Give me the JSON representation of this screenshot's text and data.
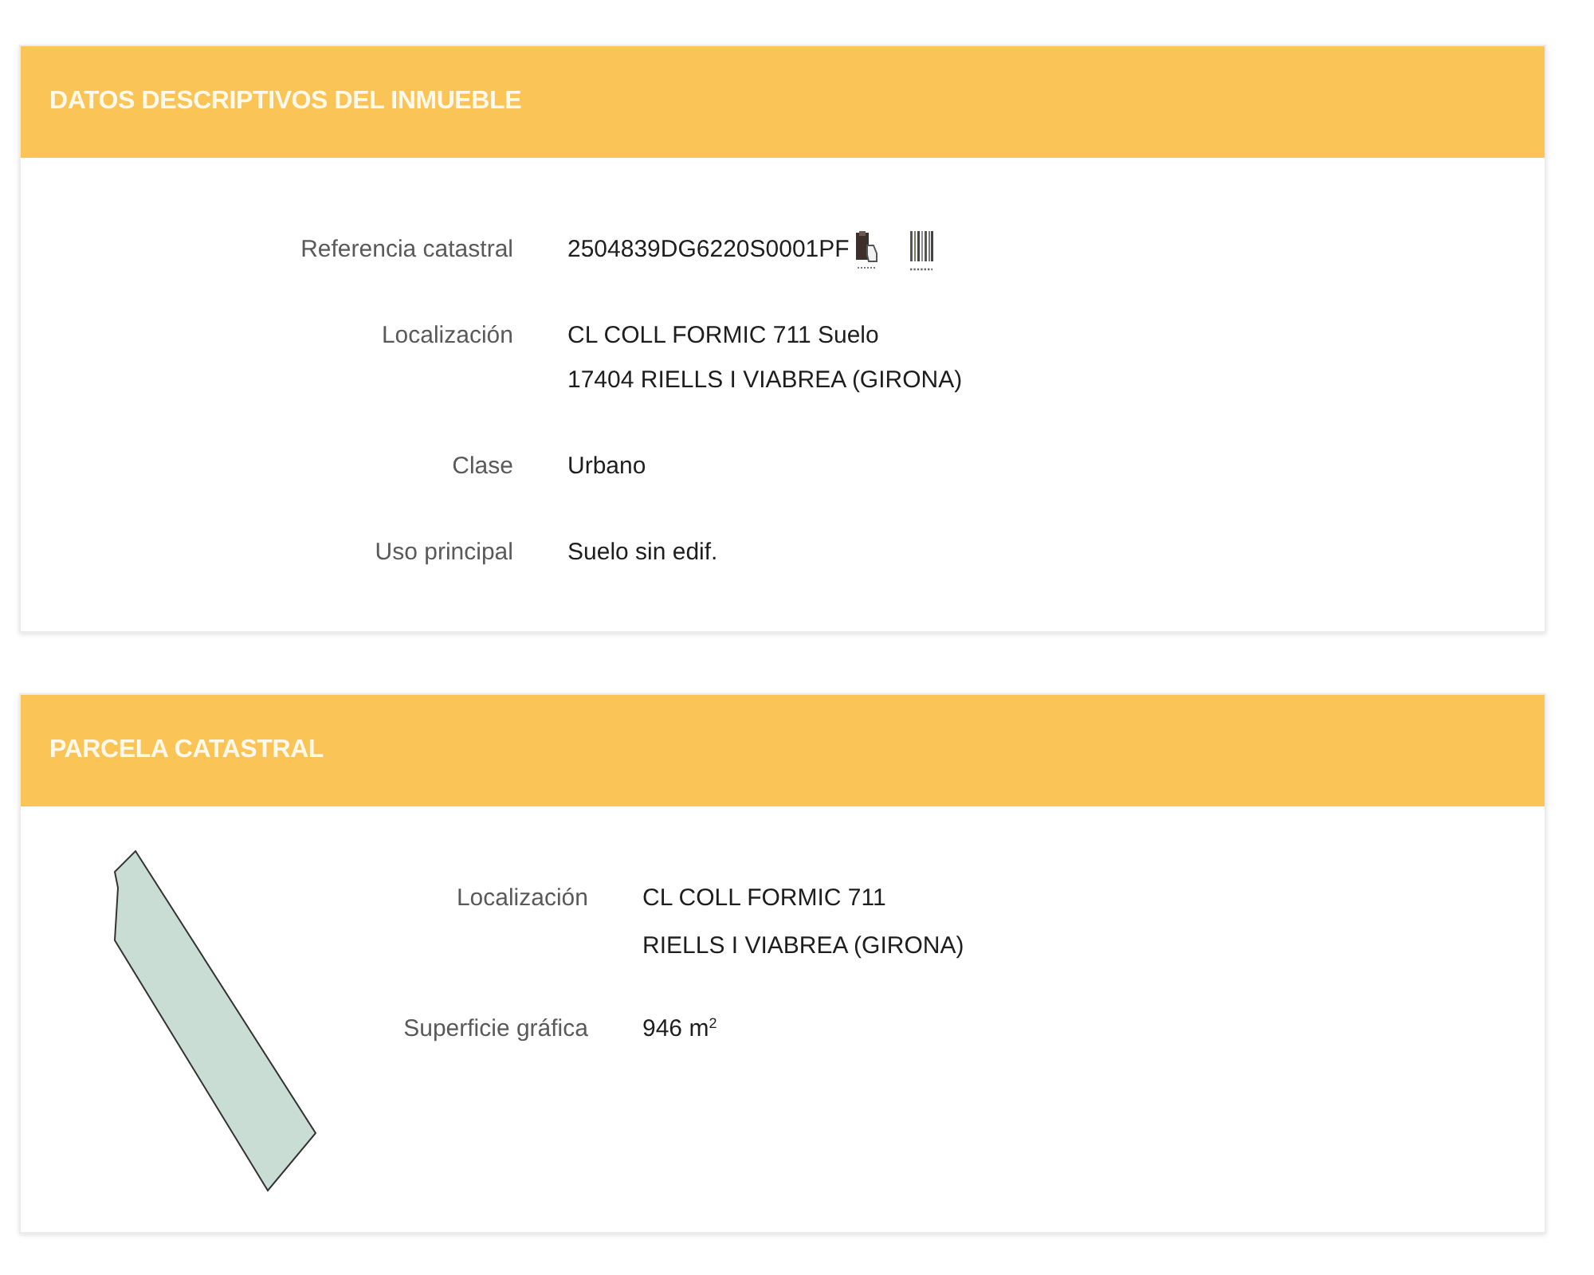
{
  "sections": [
    {
      "kind": "property",
      "title": "DATOS DESCRIPTIVOS DEL INMUEBLE",
      "fields": [
        {
          "kind": "reference",
          "label": "Referencia catastral",
          "lines": [
            "2504839DG6220S0001PF"
          ]
        },
        {
          "kind": "text",
          "label": "Localización",
          "lines": [
            "CL COLL FORMIC 711 Suelo",
            "17404 RIELLS I VIABREA (GIRONA)"
          ]
        },
        {
          "kind": "text",
          "label": "Clase",
          "lines": [
            "Urbano"
          ]
        },
        {
          "kind": "text",
          "label": "Uso principal",
          "lines": [
            "Suelo sin edif."
          ]
        }
      ]
    },
    {
      "kind": "parcel",
      "title": "PARCELA CATASTRAL",
      "fields": [
        {
          "kind": "text",
          "label": "Localización",
          "lines": [
            "CL COLL FORMIC 711",
            "RIELLS I VIABREA (GIRONA)"
          ]
        },
        {
          "kind": "text",
          "label": "Superficie gráfica",
          "lines": [
            "946 m$^{2}$"
          ]
        }
      ]
    }
  ]
}
